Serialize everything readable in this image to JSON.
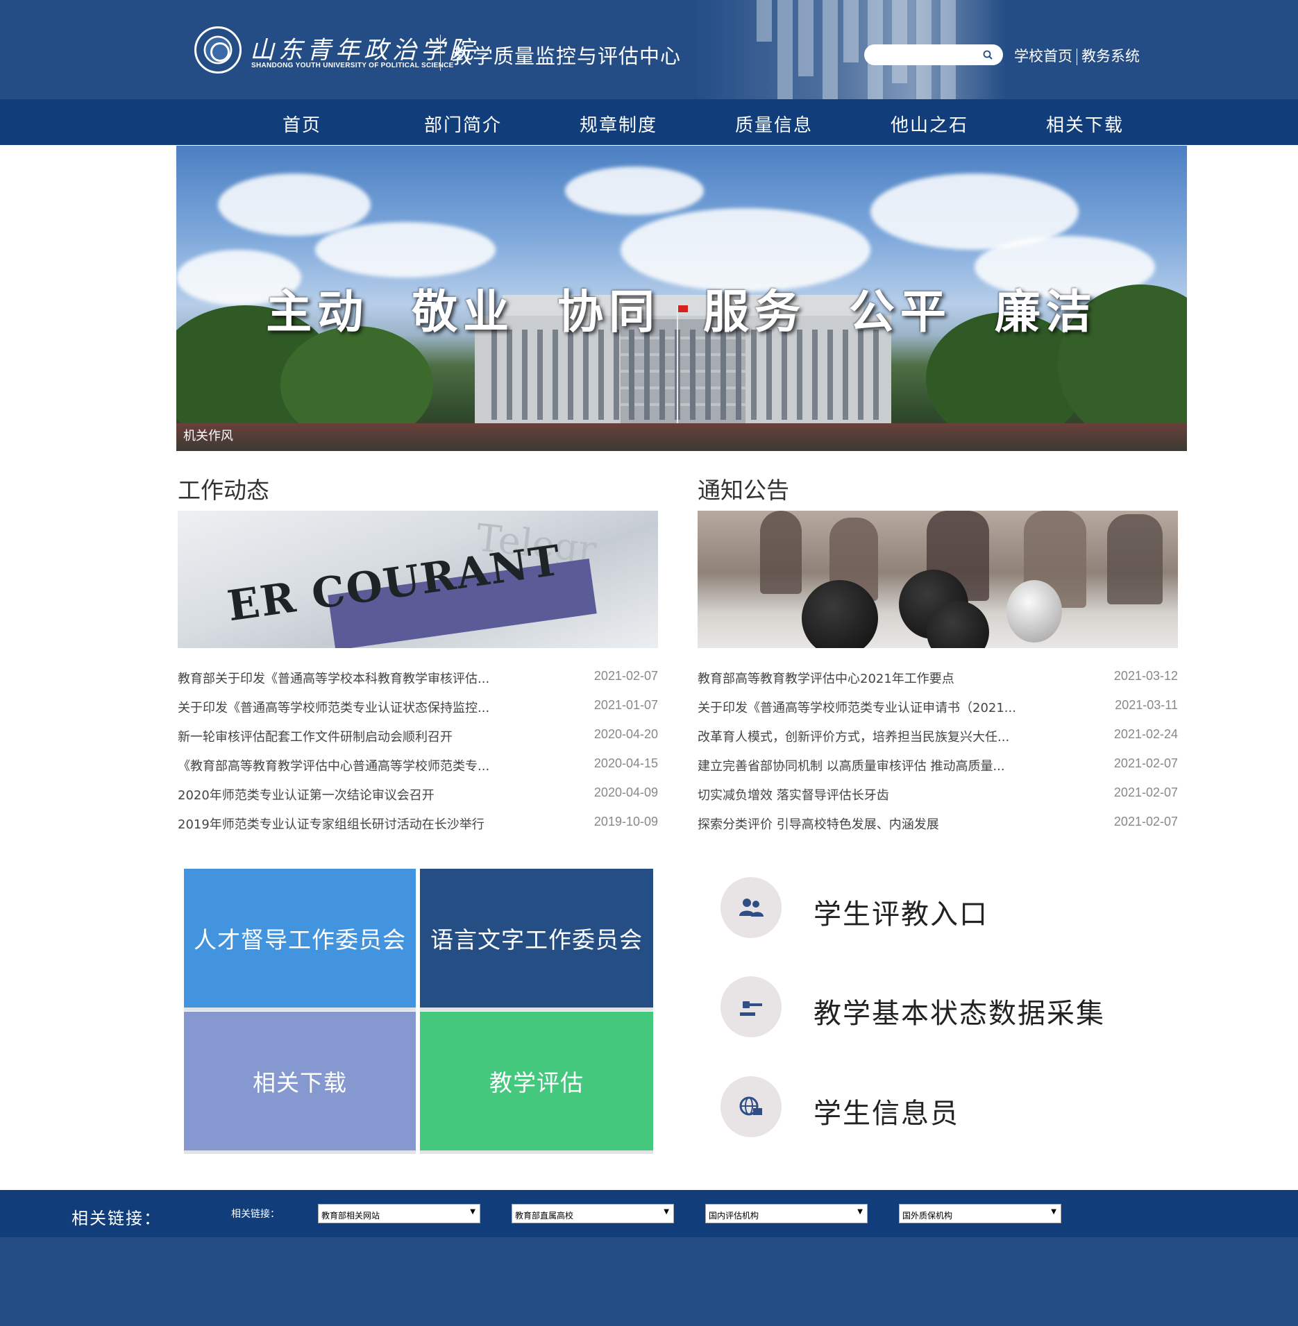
{
  "header": {
    "logo_cn": "山东青年政治学院",
    "logo_en": "SHANDONG YOUTH UNIVERSITY OF POLITICAL SCIENCE",
    "site_title": "教学质量监控与评估中心",
    "search": {
      "placeholder": "",
      "value": ""
    },
    "links": [
      "学校首页",
      "教务系统"
    ]
  },
  "nav": [
    "首页",
    "部门简介",
    "规章制度",
    "质量信息",
    "他山之石",
    "相关下载"
  ],
  "banner": {
    "slogan": "主动  敬业  协同  服务  公平  廉洁",
    "caption": "机关作风"
  },
  "news": {
    "title": "工作动态",
    "items": [
      {
        "title": "教育部关于印发《普通高等学校本科教育教学审核评估...",
        "date": "2021-02-07"
      },
      {
        "title": "关于印发《普通高等学校师范类专业认证状态保持监控...",
        "date": "2021-01-07"
      },
      {
        "title": "新一轮审核评估配套工作文件研制启动会顺利召开",
        "date": "2020-04-20"
      },
      {
        "title": "《教育部高等教育教学评估中心普通高等学校师范类专...",
        "date": "2020-04-15"
      },
      {
        "title": "2020年师范类专业认证第一次结论审议会召开",
        "date": "2020-04-09"
      },
      {
        "title": "2019年师范类专业认证专家组组长研讨活动在长沙举行",
        "date": "2019-10-09"
      }
    ]
  },
  "notices": {
    "title": "通知公告",
    "items": [
      {
        "title": "教育部高等教育教学评估中心2021年工作要点",
        "date": "2021-03-12"
      },
      {
        "title": "关于印发《普通高等学校师范类专业认证申请书（2021...",
        "date": "2021-03-11"
      },
      {
        "title": "改革育人模式，创新评价方式，培养担当民族复兴大任...",
        "date": "2021-02-24"
      },
      {
        "title": "建立完善省部协同机制 以高质量审核评估 推动高质量...",
        "date": "2021-02-07"
      },
      {
        "title": "切实减负增效 落实督导评估长牙齿",
        "date": "2021-02-07"
      },
      {
        "title": "探索分类评价 引导高校特色发展、内涵发展",
        "date": "2021-02-07"
      }
    ]
  },
  "tiles": [
    "人才督导工作委员会",
    "语言文字工作委员会",
    "相关下载",
    "教学评估"
  ],
  "entries": [
    {
      "label": "学生评教入口",
      "icon": "users-icon"
    },
    {
      "label": "教学基本状态数据采集",
      "icon": "gavel-icon"
    },
    {
      "label": "学生信息员",
      "icon": "globe-icon"
    }
  ],
  "footer": {
    "main_label": "相关链接：",
    "small_label": "相关链接：",
    "selects": [
      "教育部相关网站",
      "教育部直属高校",
      "国内评估机构",
      "国外质保机构"
    ],
    "arrow": "▼"
  },
  "colors": {
    "header": "#244d86",
    "nav": "#113d7a",
    "tile_talent": "#4394de",
    "tile_language": "#254e85",
    "tile_download": "#8698d0",
    "tile_eval": "#44c87e"
  }
}
